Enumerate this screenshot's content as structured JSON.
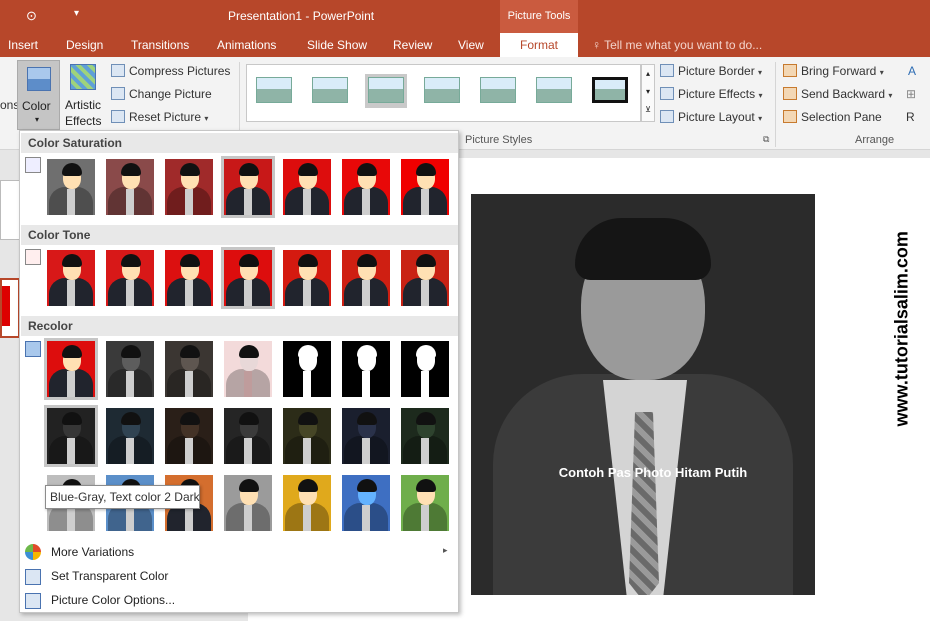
{
  "window": {
    "title": "Presentation1 - PowerPoint",
    "context_tab": "Picture Tools"
  },
  "tabs": [
    {
      "label": "Insert"
    },
    {
      "label": "Design"
    },
    {
      "label": "Transitions"
    },
    {
      "label": "Animations"
    },
    {
      "label": "Slide Show"
    },
    {
      "label": "Review"
    },
    {
      "label": "View"
    },
    {
      "label": "Format"
    }
  ],
  "tell_me": "Tell me what you want to do...",
  "ribbon": {
    "partial_left": "ons",
    "color": "Color",
    "artistic_line1": "Artistic",
    "artistic_line2": "Effects",
    "compress": "Compress Pictures",
    "change": "Change Picture",
    "reset": "Reset Picture",
    "picture_styles_label": "Picture Styles",
    "picture_border": "Picture Border",
    "picture_effects": "Picture Effects",
    "picture_layout": "Picture Layout",
    "bring_forward": "Bring Forward",
    "send_backward": "Send Backward",
    "selection_pane": "Selection Pane",
    "arrange_label": "Arrange"
  },
  "dropdown": {
    "color_saturation": "Color Saturation",
    "color_tone": "Color Tone",
    "recolor": "Recolor",
    "more_variations": "More Variations",
    "set_transparent": "Set Transparent Color",
    "color_options": "Picture Color Options...",
    "tooltip": "Blue-Gray, Text color 2 Dark",
    "saturation_bgs": [
      "#6f6f6f",
      "#8a4a4a",
      "#a02a2a",
      "#c81818",
      "#dd0d0d",
      "#e80808",
      "#f00000"
    ],
    "tone_bgs": [
      "#d81818",
      "#d81818",
      "#dc1010",
      "#dd0d0d",
      "#d41a10",
      "#cf1f12",
      "#c92214"
    ],
    "recolor_row1": [
      "#dd0d0d",
      "#3a3a3a",
      "#3b3632",
      "#f3dada",
      "#000000",
      "#000000",
      "#000000"
    ],
    "recolor_row2": [
      "#222222",
      "#1e2a33",
      "#2a1f18",
      "#252525",
      "#2c2c18",
      "#1a1f2e",
      "#1d2a1d"
    ],
    "recolor_row3": [
      "#bdbdbd",
      "#5b8fc9",
      "#d46e2e",
      "#9b9b9b",
      "#e0a91c",
      "#3e6fc2",
      "#6fae4b"
    ]
  },
  "slide": {
    "caption": "Contoh Pas Photo Hitam Putih",
    "watermark": "www.tutorialsalim.com"
  },
  "colors": {
    "accent": "#b7472a",
    "context_tab": "#ca5b3f"
  }
}
